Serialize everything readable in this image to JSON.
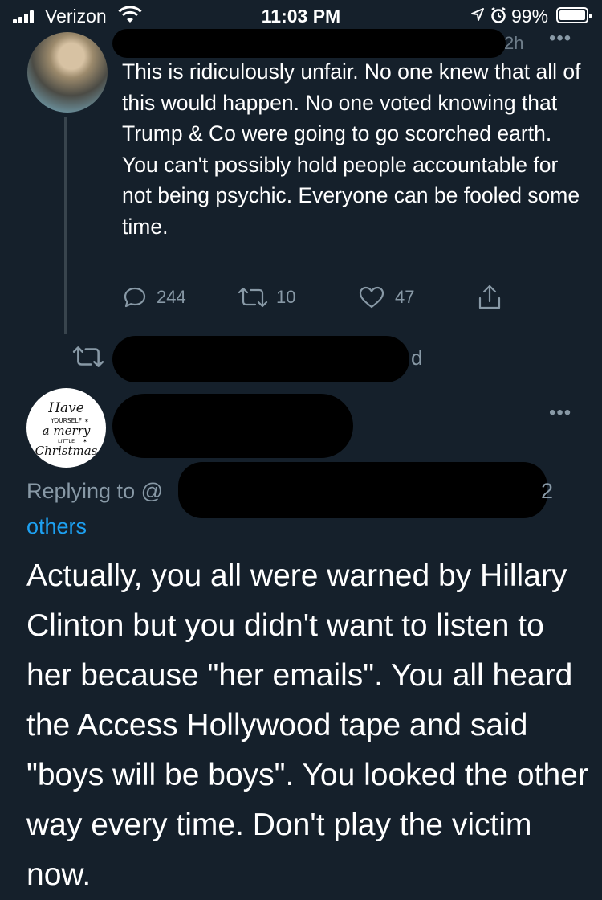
{
  "status_bar": {
    "carrier": "Verizon",
    "time": "11:03 PM",
    "battery": "99%"
  },
  "parent_tweet": {
    "time_ago": "2h",
    "more": "•••",
    "text": "This is ridiculously unfair. No one knew that all of this would happen. No one voted knowing that Trump & Co were going to go scorched earth. You can't possibly hold people accountable for not being psychic. Everyone can be fooled some time.",
    "replies": "244",
    "retweets": "10",
    "likes": "47"
  },
  "reply_tweet": {
    "retweeted_suffix": "d",
    "more": "•••",
    "avatar_text": "Have yourself a merry little Christmas",
    "replying_prefix": "Replying to @",
    "replying_trail": "2",
    "others": "others",
    "text": "Actually, you all were warned by Hillary Clinton but you didn't want to listen to her because \"her emails\". You all heard the Access Hollywood tape and said \"boys will be boys\". You looked the other way every time. Don't play the victim now."
  },
  "colors": {
    "background": "#15202b",
    "secondary_text": "#8899a6",
    "link": "#1da1f2"
  }
}
